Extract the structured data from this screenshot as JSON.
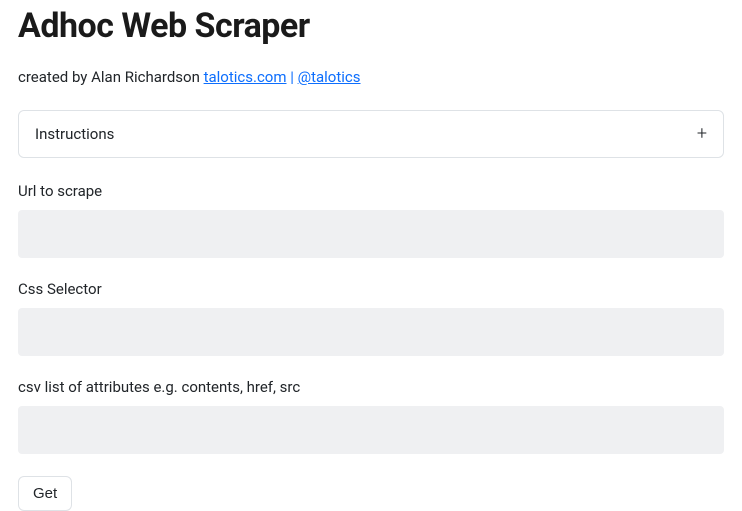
{
  "title": "Adhoc Web Scraper",
  "byline": {
    "prefix": "created by Alan Richardson ",
    "link1_text": "talotics.com",
    "separator": " | ",
    "link2_text": "@talotics"
  },
  "accordion": {
    "label": "Instructions",
    "icon": "+"
  },
  "form": {
    "url": {
      "label": "Url to scrape",
      "value": ""
    },
    "css": {
      "label": "Css Selector",
      "value": ""
    },
    "attrs": {
      "label": "csv list of attributes e.g. contents, href, src",
      "value": ""
    },
    "submit_label": "Get"
  }
}
